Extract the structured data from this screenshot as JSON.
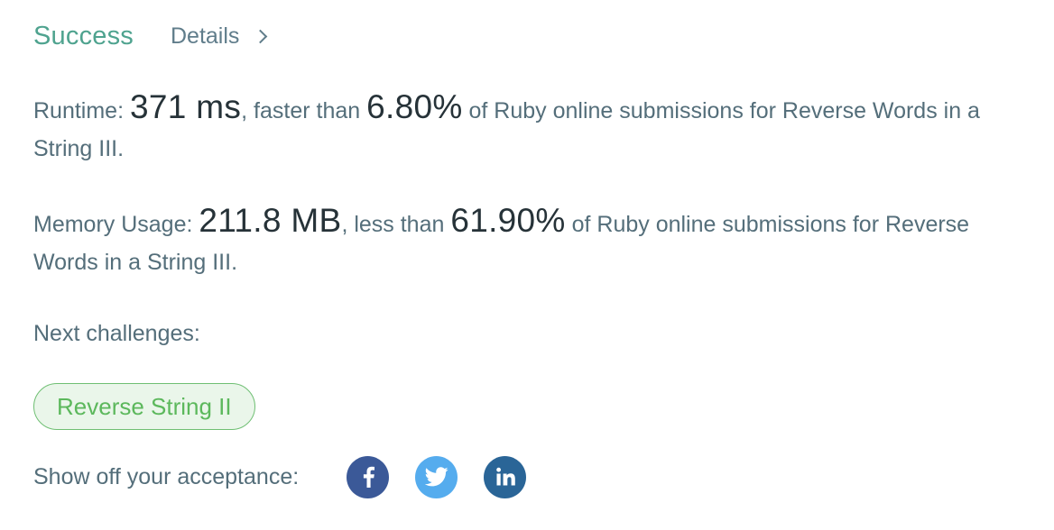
{
  "header": {
    "status": "Success",
    "details_label": "Details"
  },
  "runtime": {
    "label": "Runtime:",
    "value": "371 ms",
    "comparison": ", faster than",
    "percent": "6.80%",
    "suffix": "of Ruby online submissions for Reverse Words in a String III."
  },
  "memory": {
    "label": "Memory Usage:",
    "value": "211.8 MB",
    "comparison": ", less than",
    "percent": "61.90%",
    "suffix": "of Ruby online submissions for Reverse Words in a String III."
  },
  "next": {
    "title": "Next challenges:",
    "challenges": [
      "Reverse String II"
    ]
  },
  "share": {
    "label": "Show off your acceptance:",
    "icons": [
      "facebook-icon",
      "twitter-icon",
      "linkedin-icon"
    ]
  },
  "colors": {
    "success": "#4fa38f",
    "challenge_green": "#5cb85c",
    "facebook": "#3b5998",
    "twitter": "#55acee",
    "linkedin": "#2a6597"
  }
}
